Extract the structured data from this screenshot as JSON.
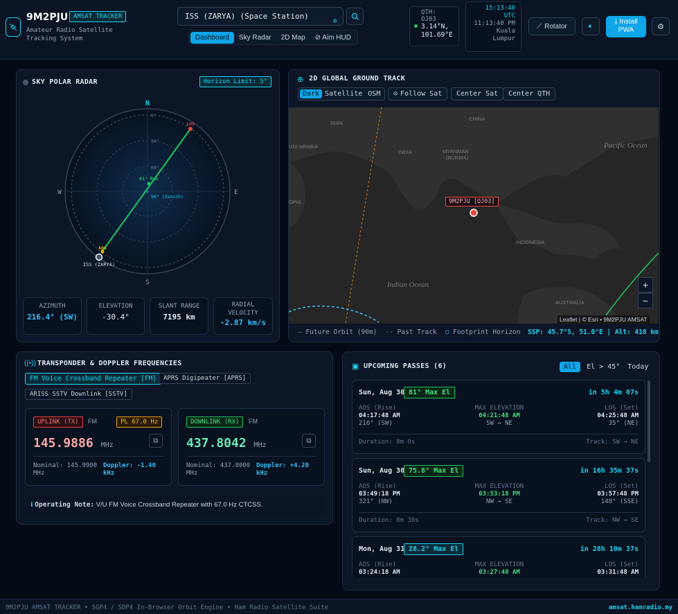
{
  "header": {
    "brand": "9M2PJU",
    "badge": "AMSAT TRACKER",
    "subtitle": "Amateur Radio Satellite Tracking System",
    "search_value": "ISS (ZARYA) (Space Station)",
    "nav": [
      "Dashboard",
      "Sky Radar",
      "2D Map",
      "Aim HUD"
    ],
    "nav_active": "Dashboard",
    "qth_label": "QTH:",
    "qth_grid": "OJ03",
    "qth_lat": "3.14°N,",
    "qth_lon": "101.69°E",
    "clock_utc": "15:13:40",
    "clock_utc_label": "UTC",
    "clock_local": "11:13:40 PM",
    "clock_city_1": "Kuala",
    "clock_city_2": "Lumpur",
    "rotator_label": "Rotator",
    "pwa_line1": "Install",
    "pwa_line2": "PWA"
  },
  "radar": {
    "title": "SKY POLAR RADAR",
    "horizon_badge": "Horizon Limit: 5°",
    "dir_n": "N",
    "dir_s": "S",
    "dir_e": "E",
    "dir_w": "W",
    "ring_0": "0°",
    "ring_30": "30°",
    "ring_60": "60°",
    "zenith_label": "90° (Zenith)",
    "max_label": "81° Max",
    "los_label": "LOS",
    "aos_label": "AOS",
    "sat_label": "ISS (ZARYA)",
    "stats": [
      {
        "label": "AZIMUTH",
        "value": "216.4° (SW)",
        "color": "#38bdf8"
      },
      {
        "label": "ELEVATION",
        "value": "-30.4°",
        "color": "#e2e8f0"
      },
      {
        "label": "SLANT RANGE",
        "value": "7195 km",
        "color": "#e2e8f0"
      },
      {
        "label": "RADIAL VELOCITY",
        "value": "-2.87 km/s",
        "color": "#38bdf8"
      }
    ]
  },
  "map": {
    "title": "2D GLOBAL GROUND TRACK",
    "layers": [
      "Dark",
      "Satellite",
      "OSM"
    ],
    "layer_active": "Dark",
    "follow": "Follow Sat",
    "center_sat": "Center Sat",
    "center_qth": "Center QTH",
    "labels": {
      "iran": "IRAN",
      "china": "CHINA",
      "india": "INDIA",
      "myanmar": "MYANMAR",
      "burma": "(BURMA)",
      "saudi": "UDI ARABIA",
      "opia": "OPIA",
      "indonesia": "INDONESIA",
      "australia": "AUSTRALIA",
      "pacific": "Pacific Ocean",
      "indian": "Indian Ocean"
    },
    "qth_marker": "9M2PJU [OJ03]",
    "zoom_in": "+",
    "zoom_out": "−",
    "attribution": "Leaflet | © Esri • 9M2PJU AMSAT",
    "legend": [
      "Future Orbit (90m)",
      "Past Track",
      "Footprint Horizon"
    ],
    "ssp": "SSP: 45.7°S, 51.0°E | Alt: 418 km"
  },
  "transponder": {
    "title": "TRANSPONDER & DOPPLER FREQUENCIES",
    "modes": [
      "FM Voice Crossband Repeater [FM]",
      "APRS Digipeater [APRS]",
      "ARISS SSTV Downlink [SSTV]"
    ],
    "uplink": {
      "tag": "UPLINK (TX)",
      "mode": "FM",
      "pl": "PL 67.0 Hz",
      "freq": "145.9886",
      "unit": "MHz",
      "nominal_1": "Nominal: 145.9900",
      "nominal_2": "MHz",
      "doppler_1": "Doppler: -1.40",
      "doppler_2": "kHz"
    },
    "downlink": {
      "tag": "DOWNLINK (RX)",
      "mode": "FM",
      "freq": "437.8042",
      "unit": "MHz",
      "nominal_1": "Nominal: 437.8000",
      "nominal_2": "MHz",
      "doppler_1": "Doppler: +4.20",
      "doppler_2": "kHz"
    },
    "note_label": "Operating Note:",
    "note_text": "V/U FM Voice Crossband Repeater with 67.0 Hz CTCSS."
  },
  "passes": {
    "title": "UPCOMING PASSES (6)",
    "filters": [
      "All",
      "El > 45°",
      "Today"
    ],
    "filter_active": "All",
    "items": [
      {
        "date": "Sun, Aug 30",
        "max_el": "81° Max El",
        "countdown": "in 5h 4m 07s",
        "aos_label": "AOS (Rise)",
        "aos_time": "04:17:48 AM",
        "aos_az": "216° (SW)",
        "max_label": "MAX ELEVATION",
        "max_time": "04:21:48 AM",
        "max_dir": "SW → NE",
        "los_label": "LOS (Set)",
        "los_time": "04:25:48 AM",
        "los_az": "35° (NE)",
        "duration": "Duration: 8m 0s",
        "track": "Track: SW → NE",
        "color": "#22c55e"
      },
      {
        "date": "Sun, Aug 30",
        "max_el": "75.8° Max El",
        "countdown": "in 16h 35m 37s",
        "aos_label": "AOS (Rise)",
        "aos_time": "03:49:18 PM",
        "aos_az": "321° (NW)",
        "max_label": "MAX ELEVATION",
        "max_time": "03:53:18 PM",
        "max_dir": "NW → SE",
        "los_label": "LOS (Set)",
        "los_time": "03:57:48 PM",
        "los_az": "148° (SSE)",
        "duration": "Duration: 8m 30s",
        "track": "Track: NW → SE",
        "color": "#22c55e"
      },
      {
        "date": "Mon, Aug 31",
        "max_el": "28.2° Max El",
        "countdown": "in 28h 10m 37s",
        "aos_label": "AOS (Rise)",
        "aos_time": "03:24:18 AM",
        "aos_az": "",
        "max_label": "MAX ELEVATION",
        "max_time": "03:27:48 AM",
        "max_dir": "",
        "los_label": "LOS (Set)",
        "los_time": "03:31:48 AM",
        "los_az": "",
        "duration": "",
        "track": "",
        "color": "#22d3ee"
      }
    ]
  },
  "footer": {
    "left": "9M2PJU AMSAT TRACKER • SGP4 / SDP4 In-Browser Orbit Engine • Ham Radio Satellite Suite",
    "right": "amsat.hamradio.my"
  }
}
